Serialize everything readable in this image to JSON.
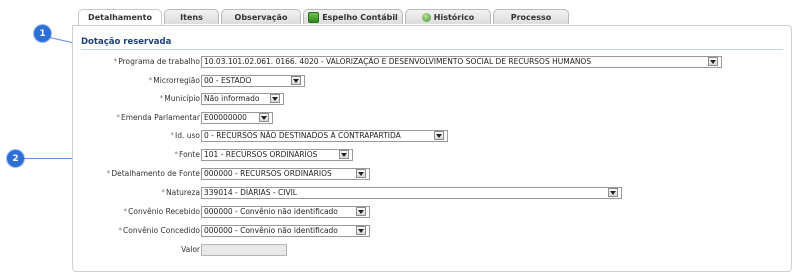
{
  "callouts": [
    "1",
    "2"
  ],
  "tabs": [
    {
      "label": "Detalhamento",
      "icon": null
    },
    {
      "label": "Itens",
      "icon": null
    },
    {
      "label": "Observação",
      "icon": null
    },
    {
      "label": "Espelho Contábil",
      "icon": "ledger-icon"
    },
    {
      "label": "Histórico",
      "icon": "history-icon"
    },
    {
      "label": "Processo",
      "icon": null
    }
  ],
  "section": {
    "title": "Dotação reservada"
  },
  "fields": [
    {
      "label": "Programa de trabalho",
      "required": true,
      "value": "10.03.101.02.061. 0166. 4020 - VALORIZAÇÃO E DESENVOLVIMENTO SOCIAL DE RECURSOS HUMANOS"
    },
    {
      "label": "Microrregião",
      "required": true,
      "value": "00 - ESTADO"
    },
    {
      "label": "Município",
      "required": true,
      "value": "Não informado"
    },
    {
      "label": "Emenda Parlamentar",
      "required": true,
      "value": "E00000000"
    },
    {
      "label": "Id. uso",
      "required": true,
      "value": "0 - RECURSOS NÃO DESTINADOS À CONTRAPARTIDA"
    },
    {
      "label": "Fonte",
      "required": true,
      "value": "101 - RECURSOS ORDINÁRIOS"
    },
    {
      "label": "Detalhamento de Fonte",
      "required": true,
      "value": "000000 - RECURSOS ORDINÁRIOS"
    },
    {
      "label": "Natureza",
      "required": true,
      "value": "339014 - DIÁRIAS - CIVIL"
    },
    {
      "label": "Convênio Recebido",
      "required": true,
      "value": "000000 - Convênio não identificado"
    },
    {
      "label": "Convênio Concedido",
      "required": true,
      "value": "000000 - Convênio não identificado"
    },
    {
      "label": "Valor",
      "required": false,
      "value": ""
    }
  ],
  "required_marker": "*",
  "colors": {
    "accent": "#2e6fd6",
    "section_title": "#1b3f7a"
  }
}
